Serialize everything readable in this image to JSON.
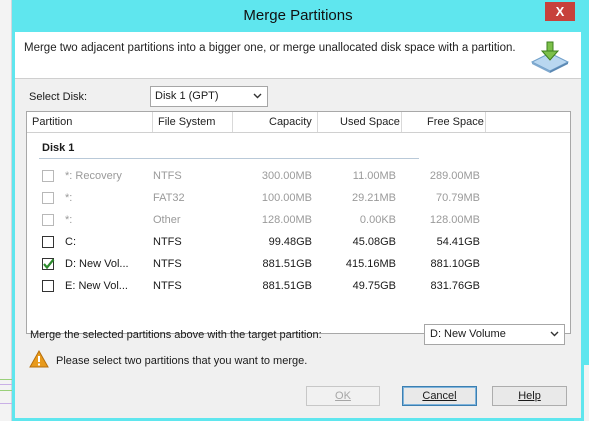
{
  "window": {
    "title": "Merge Partitions",
    "close_glyph": "X"
  },
  "description": "Merge two adjacent partitions into a bigger one, or merge unallocated disk space with a partition.",
  "header_icon": "merge-partition-icon",
  "disk_select": {
    "label": "Select Disk:",
    "value": "Disk 1 (GPT)"
  },
  "table": {
    "columns": [
      "Partition",
      "File System",
      "Capacity",
      "Used Space",
      "Free Space"
    ],
    "group": "Disk 1",
    "rows": [
      {
        "partition": "*: Recovery",
        "fs": "NTFS",
        "capacity": "300.00MB",
        "used": "11.00MB",
        "free": "289.00MB",
        "checked": false,
        "enabled": false
      },
      {
        "partition": "*:",
        "fs": "FAT32",
        "capacity": "100.00MB",
        "used": "29.21MB",
        "free": "70.79MB",
        "checked": false,
        "enabled": false
      },
      {
        "partition": "*:",
        "fs": "Other",
        "capacity": "128.00MB",
        "used": "0.00KB",
        "free": "128.00MB",
        "checked": false,
        "enabled": false
      },
      {
        "partition": "C:",
        "fs": "NTFS",
        "capacity": "99.48GB",
        "used": "45.08GB",
        "free": "54.41GB",
        "checked": false,
        "enabled": true
      },
      {
        "partition": "D: New Vol...",
        "fs": "NTFS",
        "capacity": "881.51GB",
        "used": "415.16MB",
        "free": "881.10GB",
        "checked": true,
        "enabled": true
      },
      {
        "partition": "E: New Vol...",
        "fs": "NTFS",
        "capacity": "881.51GB",
        "used": "49.75GB",
        "free": "831.76GB",
        "checked": false,
        "enabled": true
      }
    ]
  },
  "merge_target": {
    "label": "Merge the selected partitions above with the target partition:",
    "value": "D:  New Volume"
  },
  "warning": {
    "icon": "warning-icon",
    "text": "Please select two partitions that you want to merge."
  },
  "buttons": {
    "ok": "OK",
    "cancel": "Cancel",
    "help": "Help"
  },
  "colors": {
    "title_bar": "#5fe6ee",
    "checkbox_check": "#2d8a2d",
    "warning": "#e89a1c"
  }
}
